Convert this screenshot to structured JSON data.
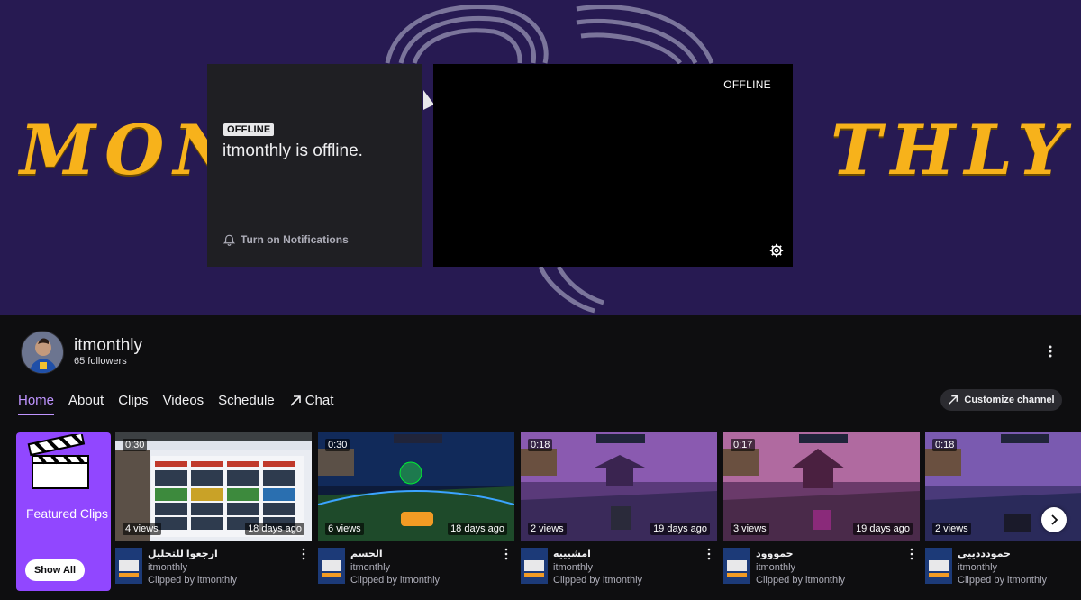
{
  "banner": {
    "text_left": "MON",
    "text_right": "THLY"
  },
  "offline_card": {
    "badge": "OFFLINE",
    "message": "itmonthly is offline.",
    "notifications_label": "Turn on Notifications"
  },
  "player": {
    "status": "OFFLINE"
  },
  "channel": {
    "name": "itmonthly",
    "followers": "65 followers"
  },
  "tabs": [
    {
      "label": "Home"
    },
    {
      "label": "About"
    },
    {
      "label": "Clips"
    },
    {
      "label": "Videos"
    },
    {
      "label": "Schedule"
    },
    {
      "label": "Chat"
    }
  ],
  "customize_label": "Customize channel",
  "featured": {
    "title": "Featured Clips",
    "show_all": "Show All"
  },
  "clips": [
    {
      "duration": "0:30",
      "views": "4 views",
      "age": "18 days ago",
      "title": "ارجعوا للتحليل",
      "channel": "itmonthly",
      "clipped_by": "Clipped by itmonthly"
    },
    {
      "duration": "0:30",
      "views": "6 views",
      "age": "18 days ago",
      "title": "الحسم",
      "channel": "itmonthly",
      "clipped_by": "Clipped by itmonthly"
    },
    {
      "duration": "0:18",
      "views": "2 views",
      "age": "19 days ago",
      "title": "امشيييه",
      "channel": "itmonthly",
      "clipped_by": "Clipped by itmonthly"
    },
    {
      "duration": "0:17",
      "views": "3 views",
      "age": "19 days ago",
      "title": "حمووود",
      "channel": "itmonthly",
      "clipped_by": "Clipped by itmonthly"
    },
    {
      "duration": "0:18",
      "views": "2 views",
      "age": "",
      "title": "حمودددييي",
      "channel": "itmonthly",
      "clipped_by": "Clipped by itmonthly"
    }
  ],
  "colors": {
    "accent": "#9147ff",
    "tab_active": "#bf94ff",
    "banner_bg": "#271a52",
    "banner_text": "#f7b21b",
    "page_bg": "#0e0e10"
  },
  "icons": {
    "notifications": "bell-icon",
    "settings": "gear-icon",
    "more": "vertical-dots-icon",
    "chat": "arrow-up-right-icon",
    "next": "chevron-right-icon",
    "featured": "clapperboard-icon"
  }
}
